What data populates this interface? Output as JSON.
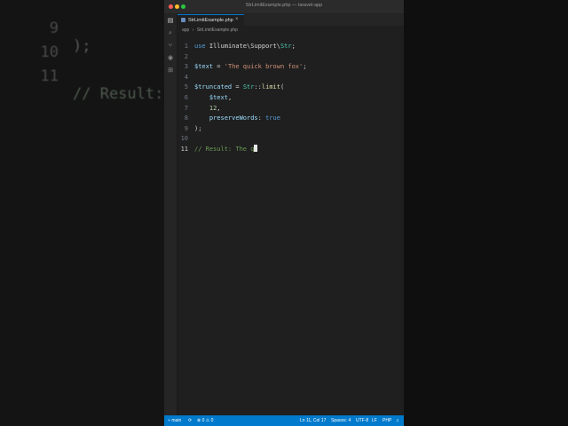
{
  "background": {
    "lines": [
      {
        "num": "9",
        "code": ");"
      },
      {
        "num": "10",
        "code": ""
      },
      {
        "num": "11",
        "code": "// Result:"
      }
    ]
  },
  "window": {
    "title": "StrLimitExample.php — laravel-app",
    "traffic_colors": [
      "#ff5f57",
      "#febc2e",
      "#28c840"
    ]
  },
  "tab": {
    "label": "StrLimitExample.php",
    "close": "×"
  },
  "breadcrumb": [
    "app",
    "›",
    "StrLimitExample.php"
  ],
  "editor": {
    "lines": [
      {
        "num": "1",
        "tokens": [
          [
            "kw",
            "use"
          ],
          [
            "plain",
            " Illuminate\\Support\\"
          ],
          [
            "cls",
            "Str"
          ],
          [
            "plain",
            ";"
          ]
        ]
      },
      {
        "num": "2",
        "tokens": []
      },
      {
        "num": "3",
        "tokens": [
          [
            "var",
            "$text"
          ],
          [
            "plain",
            " = "
          ],
          [
            "str",
            "'The quick brown fox'"
          ],
          [
            "plain",
            ";"
          ]
        ]
      },
      {
        "num": "4",
        "tokens": []
      },
      {
        "num": "5",
        "tokens": [
          [
            "var",
            "$truncated"
          ],
          [
            "plain",
            " = "
          ],
          [
            "cls",
            "Str"
          ],
          [
            "plain",
            "::"
          ],
          [
            "fn",
            "limit"
          ],
          [
            "plain",
            "("
          ]
        ]
      },
      {
        "num": "6",
        "tokens": [
          [
            "plain",
            "    "
          ],
          [
            "var",
            "$text"
          ],
          [
            "plain",
            ","
          ]
        ]
      },
      {
        "num": "7",
        "tokens": [
          [
            "plain",
            "    "
          ],
          [
            "num",
            "12"
          ],
          [
            "plain",
            ","
          ]
        ]
      },
      {
        "num": "8",
        "tokens": [
          [
            "plain",
            "    "
          ],
          [
            "var",
            "preserveWords"
          ],
          [
            "plain",
            ": "
          ],
          [
            "bool",
            "true"
          ]
        ]
      },
      {
        "num": "9",
        "tokens": [
          [
            "plain",
            ");"
          ]
        ]
      },
      {
        "num": "10",
        "tokens": []
      },
      {
        "num": "11",
        "tokens": [
          [
            "cm",
            "// Result: The q"
          ]
        ],
        "cursor": true
      }
    ]
  },
  "statusbar": {
    "branch": "main",
    "sync": "⟳",
    "problems": "⊗ 0 ⚠ 0",
    "position": "Ln 11, Col 17",
    "spaces": "Spaces: 4",
    "encoding": "UTF-8",
    "eol": "LF",
    "language": "PHP",
    "bell": "♫"
  },
  "colors": {
    "accent": "#007acc",
    "editor_bg": "#1f1f1f",
    "comment": "#6a9955",
    "string": "#ce9178",
    "variable": "#9cdcfe",
    "keyword": "#569cd6"
  }
}
